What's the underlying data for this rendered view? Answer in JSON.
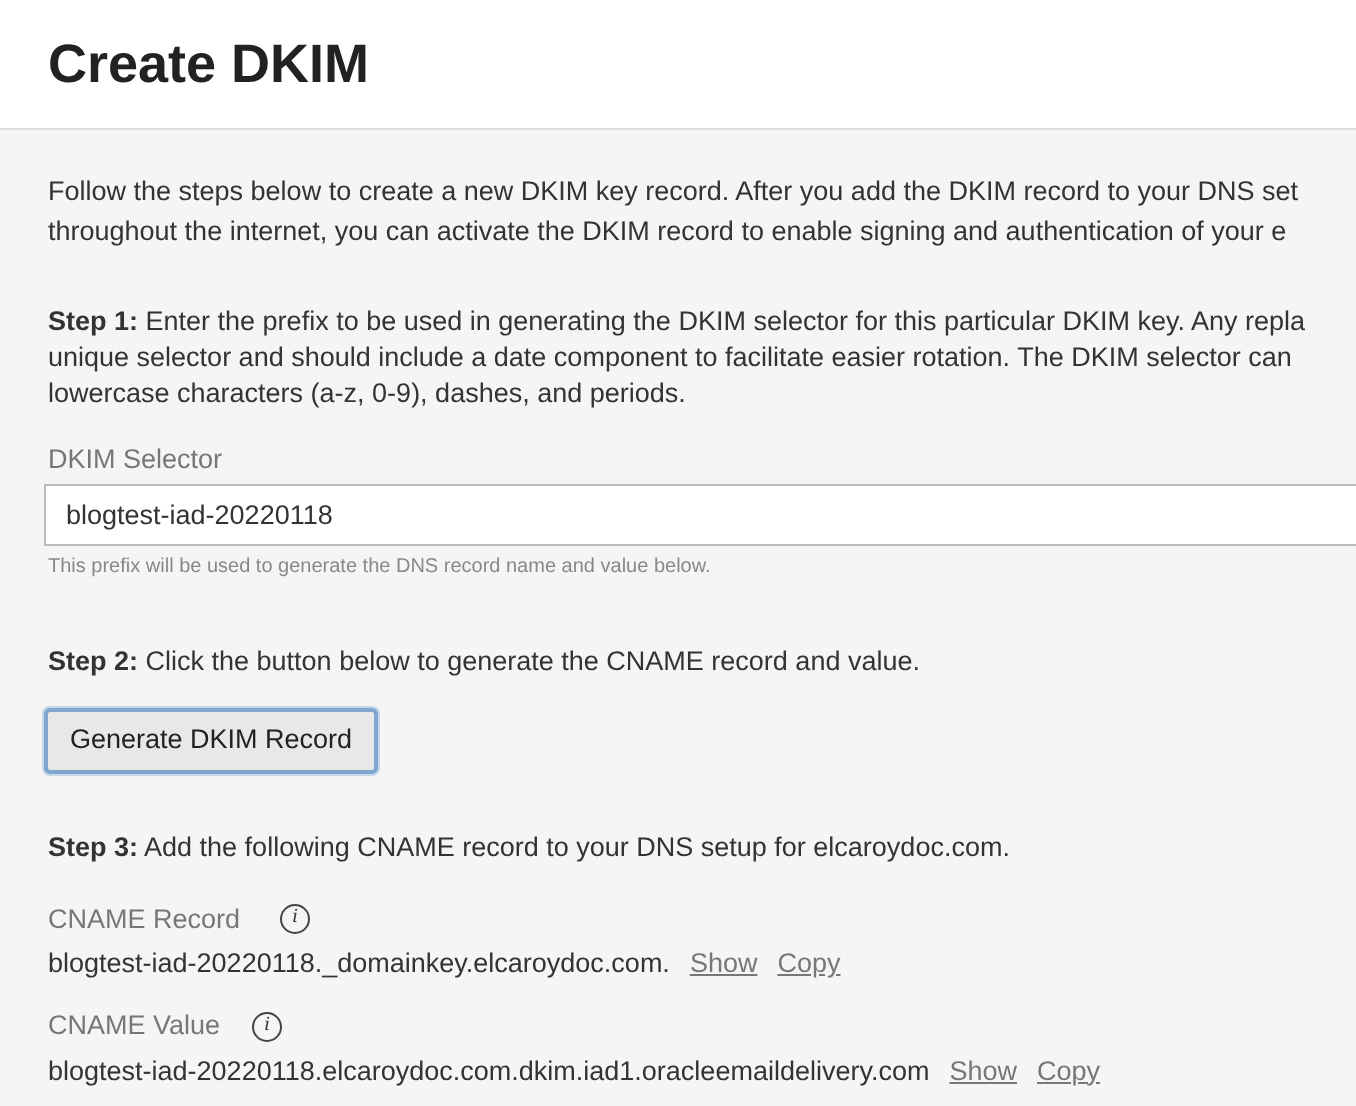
{
  "header": {
    "title": "Create DKIM"
  },
  "intro": {
    "lines": [
      "Follow the steps below to create a new DKIM key record. After you add the DKIM record to your DNS set",
      "throughout the internet, you can activate the DKIM record to enable signing and authentication of your e"
    ]
  },
  "step_1": {
    "lines": [
      "**Step 1:** Enter the prefix to be used in generating the DKIM selector for this particular DKIM key. Any repla",
      "unique selector and should include a date component to facilitate easier rotation. The DKIM selector can",
      "lowercase characters (a-z, 0-9), dashes, and periods."
    ]
  },
  "selector_field": {
    "label": "DKIM Selector",
    "value": "blogtest-iad-20220118",
    "help": "This prefix will be used to generate the DNS record name and value below."
  },
  "step_2": {
    "text": "**Step 2:** Click the button below to generate the CNAME record and value."
  },
  "generate_button": {
    "label": "Generate DKIM Record",
    "focused": true
  },
  "step_3": {
    "text": "**Step 3:** Add the following CNAME record to your DNS setup for elcaroydoc.com."
  },
  "records": [
    {
      "label": "CNAME Record",
      "info_icon": "i",
      "value": "blogtest-iad-20220118._domainkey.elcaroydoc.com.",
      "show": "Show",
      "copy": "Copy"
    },
    {
      "label": "CNAME Value",
      "info_icon": "i",
      "value": "blogtest-iad-20220118.elcaroydoc.com.dkim.iad1.oracleemaildelivery.com",
      "show": "Show",
      "copy": "Copy"
    }
  ]
}
